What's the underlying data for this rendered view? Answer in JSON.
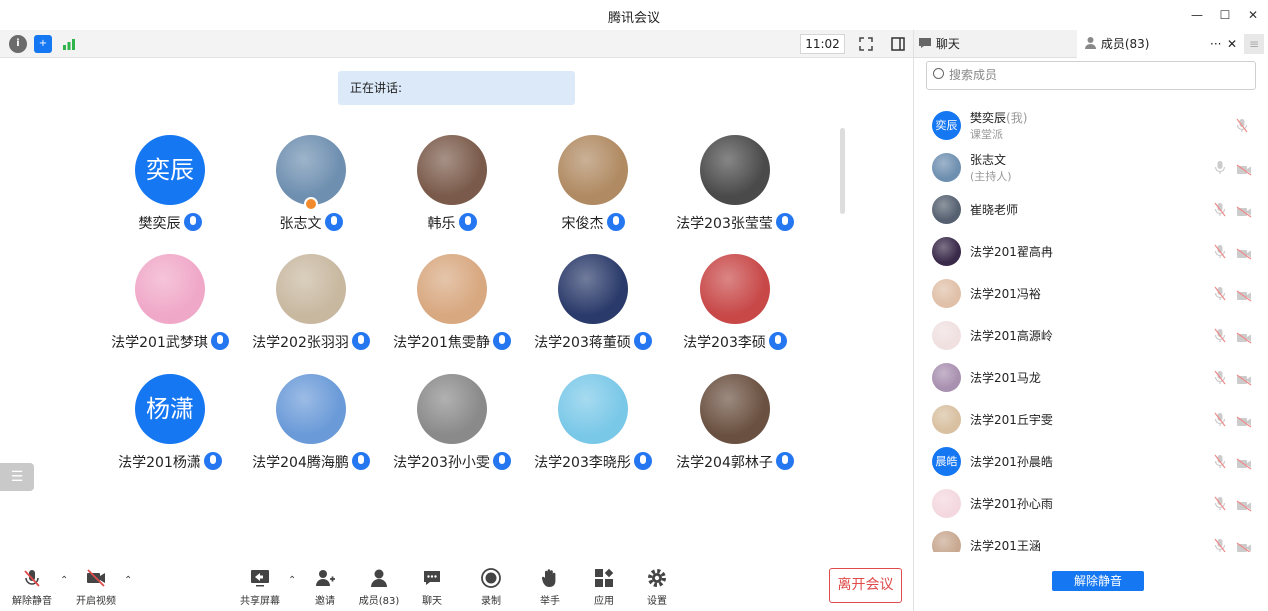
{
  "window": {
    "title": "腾讯会议",
    "minimize": "—",
    "maximize": "☐",
    "close": "✕"
  },
  "toolbar": {
    "time": "11:02"
  },
  "stage": {
    "speaking_label": "正在讲话:",
    "participants": [
      {
        "name": "樊奕辰",
        "avatar_text": "奕辰",
        "avatar_color": "#1677f2"
      },
      {
        "name": "张志文",
        "avatar_color": "#6e8fb0"
      },
      {
        "name": "韩乐",
        "avatar_color": "#7a5a4a"
      },
      {
        "name": "宋俊杰",
        "avatar_color": "#b08a62"
      },
      {
        "name": "法学203张莹莹",
        "avatar_color": "#4a4a4a"
      },
      {
        "name": "法学201武梦琪",
        "avatar_color": "#f0a8c8"
      },
      {
        "name": "法学202张羽羽",
        "avatar_color": "#c8b8a0"
      },
      {
        "name": "法学201焦雯静",
        "avatar_color": "#d8a880"
      },
      {
        "name": "法学203蒋董硕",
        "avatar_color": "#2a3a6a"
      },
      {
        "name": "法学203李硕",
        "avatar_color": "#c84848"
      },
      {
        "name": "法学201杨潇",
        "avatar_text": "杨潇",
        "avatar_color": "#1677f2"
      },
      {
        "name": "法学204腾海鹏",
        "avatar_color": "#6a9ad8"
      },
      {
        "name": "法学203孙小雯",
        "avatar_color": "#8a8a8a"
      },
      {
        "name": "法学203李晓彤",
        "avatar_color": "#7ac8e8"
      },
      {
        "name": "法学204郭林子",
        "avatar_color": "#6a5040"
      }
    ]
  },
  "bottom": {
    "unmute": "解除静音",
    "start_video": "开启视频",
    "share_screen": "共享屏幕",
    "invite": "邀请",
    "members": "成员(83)",
    "chat": "聊天",
    "record": "录制",
    "raise_hand": "举手",
    "apps": "应用",
    "settings": "设置",
    "leave": "离开会议"
  },
  "panel": {
    "tab_chat": "聊天",
    "tab_members": "成员(83)",
    "more": "···",
    "close": "✕",
    "search_placeholder": "搜索成员",
    "unmute_all": "解除静音",
    "members": [
      {
        "name": "樊奕辰",
        "tag": "(我)",
        "sub": "课堂派",
        "avatar_text": "奕辰",
        "avatar_color": "#1677f2"
      },
      {
        "name": "张志文",
        "sub": "(主持人)",
        "avatar_color": "#6e8fb0"
      },
      {
        "name": "崔晓老师",
        "avatar_color": "#556070"
      },
      {
        "name": "法学201翟高冉",
        "avatar_color": "#3a2a4a"
      },
      {
        "name": "法学201冯裕",
        "avatar_color": "#e0c0a8"
      },
      {
        "name": "法学201高源岭",
        "avatar_color": "#f0e0e0"
      },
      {
        "name": "法学201马龙",
        "avatar_color": "#a890b0"
      },
      {
        "name": "法学201丘宇雯",
        "avatar_color": "#d8c0a0"
      },
      {
        "name": "法学201孙晨皓",
        "avatar_text": "晨皓",
        "avatar_color": "#1677f2"
      },
      {
        "name": "法学201孙心雨",
        "avatar_color": "#f4d8e0"
      },
      {
        "name": "法学201王涵",
        "avatar_color": "#c8a890"
      }
    ]
  }
}
